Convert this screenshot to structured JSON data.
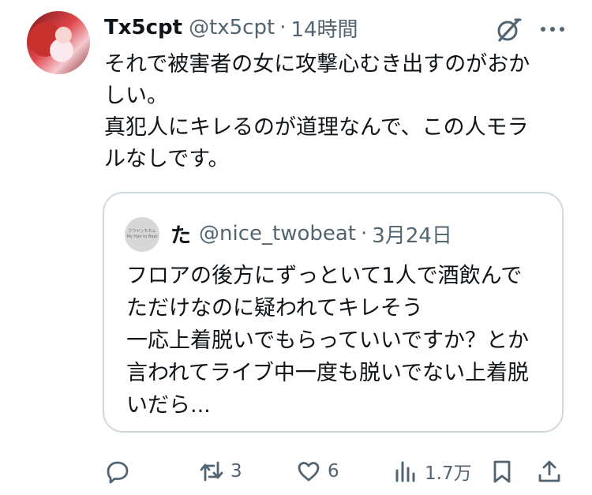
{
  "author": {
    "name": "Tx5cpt",
    "handle": "@tx5cpt",
    "time": "14時間"
  },
  "tweet": {
    "lines": [
      "それで被害者の女に攻撃心むき出すのがおか",
      "しい。",
      "真犯人にキレるのが道理なんで、この人モラ",
      "ルなしです。"
    ]
  },
  "quote": {
    "avatar_text": [
      "クウヤンモモム",
      "My Hair to Beat"
    ],
    "name": "た",
    "handle": "@nice_twobeat",
    "dot": "·",
    "date": "3月24日",
    "lines": [
      "フロアの後方にずっといて1人で酒飲んで",
      "ただけなのに疑われてキレそう",
      "一応上着脱いでもらっていいですか？とか",
      "言われてライブ中一度も脱いでない上着脱",
      "いだら..."
    ]
  },
  "actions": {
    "reposts": "3",
    "likes": "6",
    "views": "1.7万"
  },
  "icons": {
    "grok": "grok-icon",
    "more": "more-icon",
    "reply": "reply-icon",
    "repost": "repost-icon",
    "like": "heart-icon",
    "views": "views-icon",
    "bookmark": "bookmark-icon",
    "share": "share-icon"
  },
  "colors": {
    "text": "#0f1419",
    "secondary": "#536471",
    "border": "#cfd9de"
  }
}
